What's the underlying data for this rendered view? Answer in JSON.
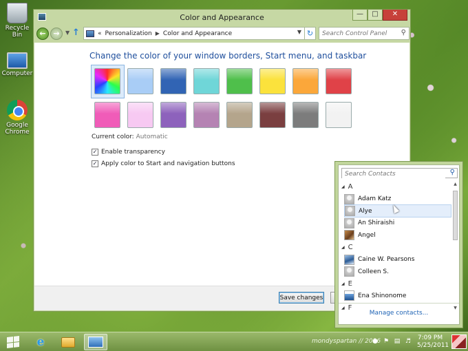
{
  "desktop": {
    "icons": [
      {
        "label": "Recycle Bin"
      },
      {
        "label": "Computer"
      },
      {
        "label": "Google Chrome"
      }
    ]
  },
  "window": {
    "title": "Color and Appearance",
    "address": {
      "crumbs": [
        "«",
        "Personalization",
        "Color and Appearance"
      ],
      "search_placeholder": "Search Control Panel"
    },
    "heading": "Change the color of your window borders, Start menu, and taskbar",
    "swatches": [
      {
        "color": "conic",
        "selected": true
      },
      {
        "color": "#a9cdf6"
      },
      {
        "color": "#3164b4"
      },
      {
        "color": "#6fd6d8"
      },
      {
        "color": "#4fbf4b"
      },
      {
        "color": "#fbe23c"
      },
      {
        "color": "#fba73a"
      },
      {
        "color": "#e04248"
      },
      {
        "color": "#f05cb8"
      },
      {
        "color": "#f7c9f2"
      },
      {
        "color": "#8d62bc"
      },
      {
        "color": "#b583b3"
      },
      {
        "color": "#b4a58c"
      },
      {
        "color": "#7a3f40"
      },
      {
        "color": "#7c7c7c"
      },
      {
        "color": "#f2f2f2"
      }
    ],
    "current_color_label": "Current color:",
    "current_color_value": "Automatic",
    "checkboxes": [
      {
        "label": "Enable transparency",
        "checked": true
      },
      {
        "label": "Apply color to Start and navigation buttons",
        "checked": true
      }
    ],
    "save_label": "Save changes"
  },
  "contacts": {
    "search_placeholder": "Search Contacts",
    "rows": [
      {
        "kind": "letter",
        "text": "A"
      },
      {
        "kind": "person",
        "text": "Adam Katz",
        "avatar": "default"
      },
      {
        "kind": "person",
        "text": "Alye",
        "avatar": "default",
        "highlight": true
      },
      {
        "kind": "person",
        "text": "An Shiraishi",
        "avatar": "default"
      },
      {
        "kind": "person",
        "text": "Angel",
        "avatar": "pic1"
      },
      {
        "kind": "letter",
        "text": "C"
      },
      {
        "kind": "person",
        "text": "Caine W. Pearsons",
        "avatar": "pic2"
      },
      {
        "kind": "person",
        "text": "Colleen S.",
        "avatar": "default"
      },
      {
        "kind": "letter",
        "text": "E"
      },
      {
        "kind": "person",
        "text": "Ena Shinonome",
        "avatar": "pic3"
      },
      {
        "kind": "letter",
        "text": "F"
      }
    ],
    "manage_label": "Manage contacts..."
  },
  "taskbar": {
    "user_text": "mondyspartan // 2026",
    "time": "7:09 PM",
    "date": "5/25/2011"
  },
  "colors": {
    "accent": "#1e4e9c",
    "window_frame": "#c6d8a4",
    "link": "#1d62b4"
  }
}
